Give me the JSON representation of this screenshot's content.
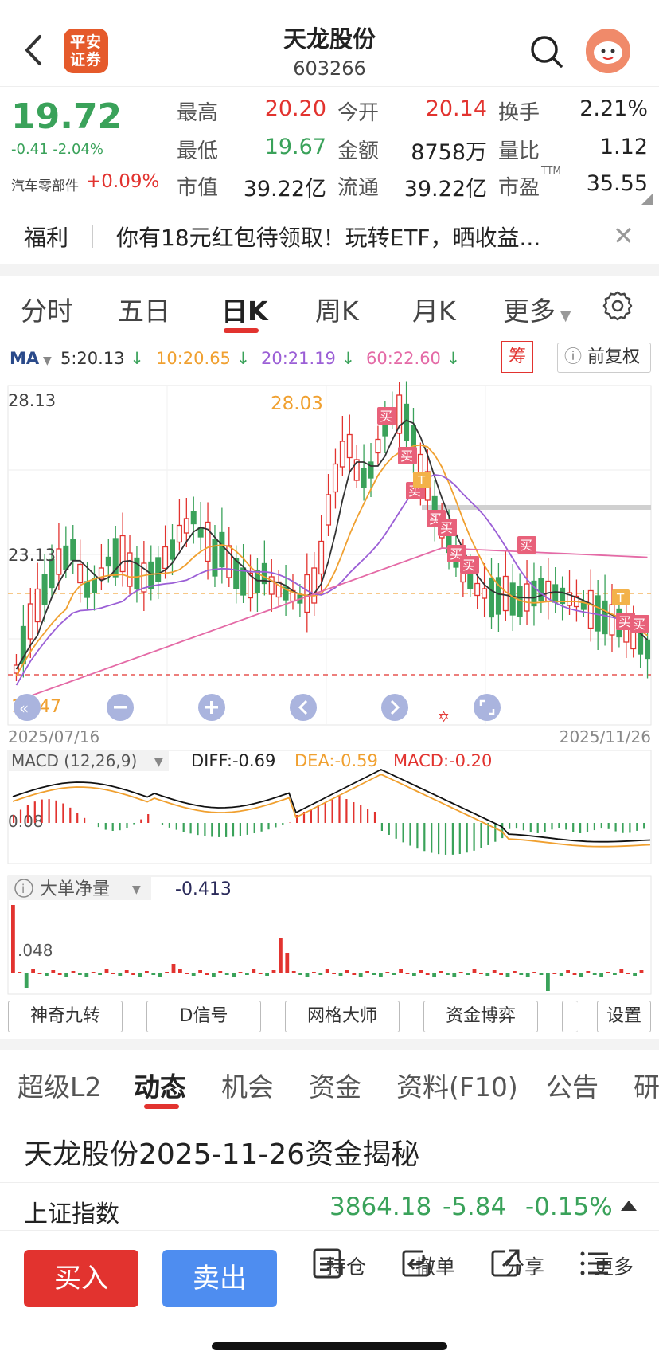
{
  "header": {
    "logo_text": "平安证券",
    "title": "天龙股份",
    "code": "603266"
  },
  "quote": {
    "price": "19.72",
    "change": "-0.41",
    "change_pct": "-2.04%",
    "sector": "汽车零部件",
    "sector_change": "+0.09%",
    "high_label": "最高",
    "high": "20.20",
    "open_label": "今开",
    "open": "20.14",
    "turnover_label": "换手",
    "turnover": "2.21%",
    "low_label": "最低",
    "low": "19.67",
    "amount_label": "金额",
    "amount": "8758万",
    "vol_ratio_label": "量比",
    "vol_ratio": "1.12",
    "mcap_label": "市值",
    "mcap": "39.22亿",
    "float_label": "流通",
    "float": "39.22亿",
    "pe_label": "市盈",
    "pe_sup": "TTM",
    "pe": "35.55"
  },
  "notice": {
    "tag": "福利",
    "text": "你有18元红包待领取！玩转ETF，晒收益..."
  },
  "period_tabs": [
    "分时",
    "五日",
    "日K",
    "周K",
    "月K",
    "更多"
  ],
  "active_period": "日K",
  "ma": {
    "label": "MA",
    "ma5": "5:20.13",
    "ma10": "10:20.65",
    "ma20": "20:21.19",
    "ma60": "60:22.60",
    "chou": "筹",
    "adjust": "前复权"
  },
  "kline": {
    "y_top": "28.13",
    "y_mid": "23.13",
    "high_mark": "28.03",
    "low_mark": "19.47",
    "date_start": "2025/07/16",
    "date_end": "2025/11/26",
    "buy_tag": "买",
    "t_tag": "T"
  },
  "macd": {
    "label": "MACD (12,26,9)",
    "diff": "DIFF:-0.69",
    "dea": "DEA:-0.59",
    "macd": "MACD:-0.20",
    "axis": "0.08"
  },
  "big_order": {
    "label": "大单净量",
    "value": "-0.413",
    "axis": ".048"
  },
  "indicator_buttons": [
    "神奇九转",
    "D信号",
    "网格大师",
    "资金博弈",
    "设置"
  ],
  "content_tabs": [
    "超级L2",
    "动态",
    "机会",
    "资金",
    "资料(F10)",
    "公告",
    "研"
  ],
  "active_content_tab": "动态",
  "news_title": "天龙股份2025-11-26资金揭秘",
  "index": {
    "name": "上证指数",
    "value": "3864.18",
    "change": "-5.84",
    "pct": "-0.15%"
  },
  "bottom": {
    "buy": "买入",
    "sell": "卖出",
    "items": [
      "持仓",
      "撤单",
      "分享",
      "更多"
    ]
  },
  "colors": {
    "up": "#e2332f",
    "down": "#3aa25a",
    "ma5": "#333333",
    "ma10": "#f0a030",
    "ma20": "#9b5fd6",
    "ma60": "#e46aa6",
    "sell_button": "#4e8df0"
  }
}
